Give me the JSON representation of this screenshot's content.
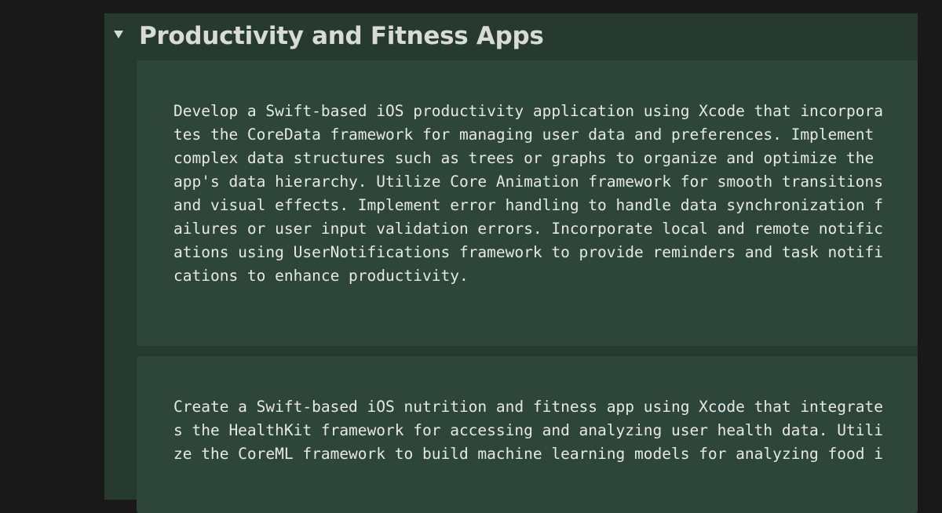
{
  "toggle": {
    "title": "Productivity and Fitness Apps",
    "expanded": true,
    "arrow_icon": "triangle-down-icon"
  },
  "blocks": [
    {
      "lines": [
        "Develop a Swift-based iOS productivity application using Xcode that incorpora",
        "tes the CoreData framework for managing user data and preferences. Implement",
        "complex data structures such as trees or graphs to organize and optimize the",
        "app's data hierarchy. Utilize Core Animation framework for smooth transitions",
        "and visual effects. Implement error handling to handle data synchronization f",
        "ailures or user input validation errors. Incorporate local and remote notific",
        "ations using UserNotifications framework to provide reminders and task notifi",
        "cations to enhance productivity."
      ]
    },
    {
      "lines": [
        "Create a Swift-based iOS nutrition and fitness app using Xcode that integrate",
        "s the HealthKit framework for accessing and analyzing user health data. Utili",
        "ze the CoreML framework to build machine learning models for analyzing food i"
      ]
    }
  ],
  "colors": {
    "page_background": "#191919",
    "toggle_background": "#263a2f",
    "code_background": "#2d4639",
    "title_text": "#d9dbd9",
    "code_text": "#e6e8e6"
  }
}
